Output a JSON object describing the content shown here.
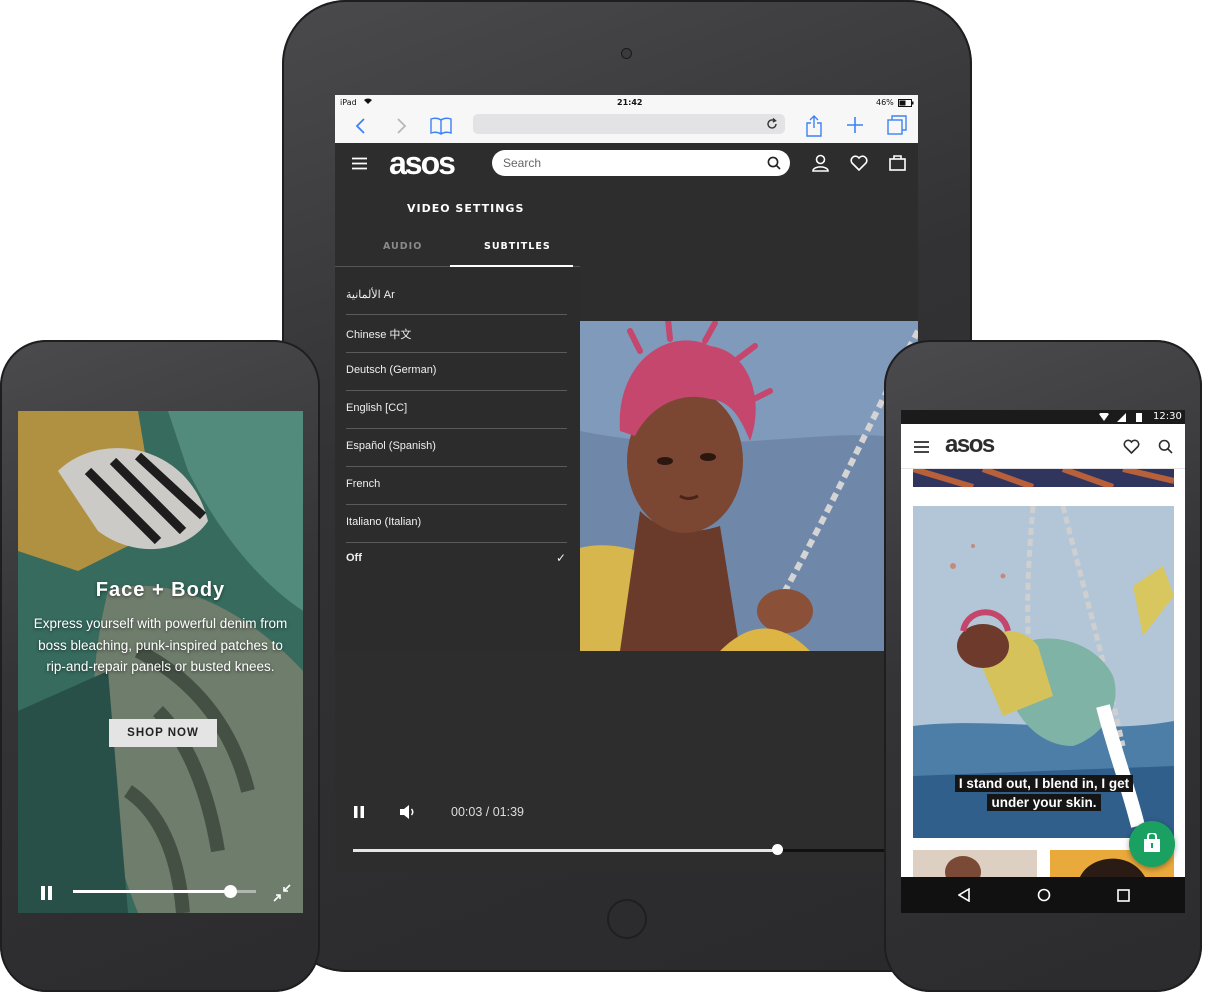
{
  "tablet": {
    "status": {
      "device": "iPad",
      "time": "21:42",
      "battery": "46%"
    },
    "app": {
      "logo": "asos",
      "search_placeholder": "Search"
    },
    "video_settings": {
      "title": "VIDEO SETTINGS",
      "tabs": [
        {
          "label": "AUDIO",
          "active": false
        },
        {
          "label": "SUBTITLES",
          "active": true
        }
      ],
      "languages": [
        "الألمانية Ar",
        "Chinese 中文",
        "Deutsch (German)",
        "English [CC]",
        "Español (Spanish)",
        "French",
        "Italiano (Italian)",
        "Off"
      ],
      "selected": "Off",
      "check_mark": "✓"
    },
    "player": {
      "time": "00:03 / 01:39",
      "progress": 0.75
    }
  },
  "phone_left": {
    "promo": {
      "title": "Face + Body",
      "body": "Express yourself with powerful denim from boss bleaching, punk-inspired patches to rip-and-repair panels or busted knees.",
      "cta": "SHOP NOW"
    },
    "player": {
      "progress": 0.86
    }
  },
  "phone_right": {
    "status": {
      "time": "12:30"
    },
    "app": {
      "logo": "asos"
    },
    "caption": "I stand out, I blend in, I get under your skin."
  },
  "colors": {
    "app_dark": "#2d2d2d",
    "accent_green": "#1aa161",
    "device_body": "#343436"
  }
}
